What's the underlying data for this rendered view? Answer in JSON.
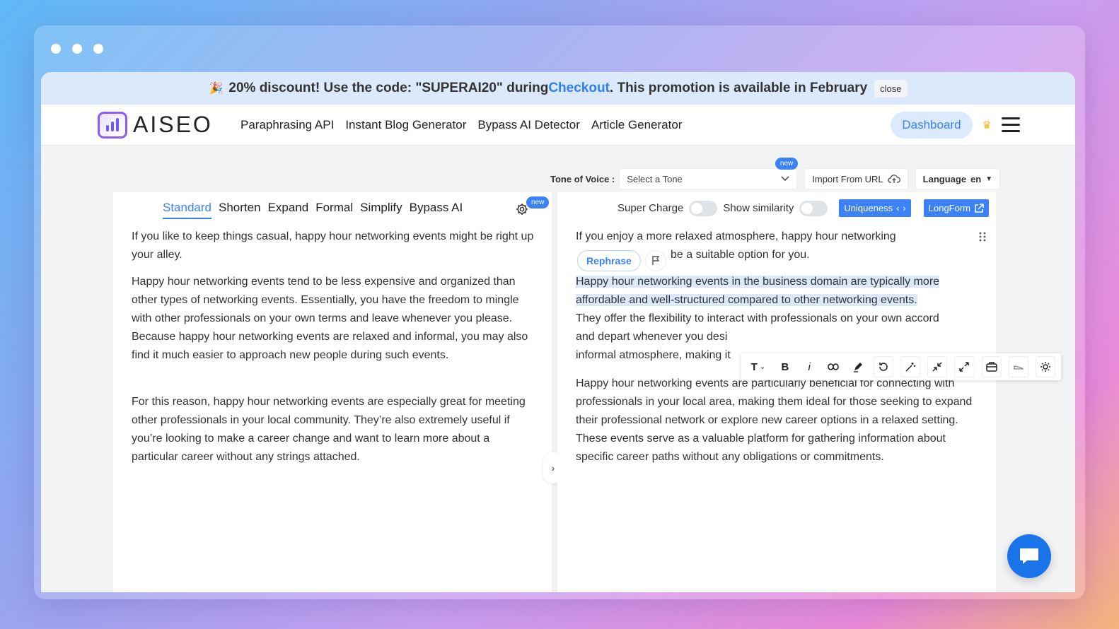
{
  "promo": {
    "emoji": "🎉",
    "text_before": "20% discount! Use the code: \"SUPERAI20\" during ",
    "link": "Checkout",
    "text_after": ". This promotion is available in February",
    "close_label": "close"
  },
  "nav": {
    "logo_text": "AISEO",
    "links": [
      "Paraphrasing API",
      "Instant Blog Generator",
      "Bypass AI Detector",
      "Article Generator"
    ],
    "dashboard_label": "Dashboard"
  },
  "toolbar": {
    "tone_label": "Tone of Voice :",
    "tone_placeholder": "Select a Tone",
    "new_badge": "new",
    "import_label": "Import From URL",
    "language_label": "Language",
    "language_value": "en"
  },
  "left": {
    "tabs": [
      "Standard",
      "Shorten",
      "Expand",
      "Formal",
      "Simplify",
      "Bypass AI"
    ],
    "active_tab": "Standard",
    "settings_badge": "new",
    "paragraphs": [
      "If you like to keep things casual, happy hour networking events might be right up your alley.",
      "Happy hour networking events tend to be less expensive and organized than other types of networking events. Essentially, you have the freedom to mingle with other professionals on your own terms and leave whenever you please. Because happy hour networking events are relaxed and informal, you may also find it much easier to approach new people during such events.",
      "For this reason, happy hour networking events are especially great for meeting other professionals in your local community. They’re also extremely useful if you’re looking to make a career change and want to learn more about a particular career without any strings attached."
    ]
  },
  "right": {
    "super_charge_label": "Super Charge",
    "show_similarity_label": "Show similarity",
    "uniqueness_label": "Uniqueness",
    "longform_label": "LongForm",
    "rephrase_label": "Rephrase",
    "p1_line1": "If you enjoy a more relaxed atmosphere, happy hour networking",
    "p1_line2": "be a suitable option for you.",
    "p2_highlight": "Happy hour networking events in the business domain are typically more affordable and well-structured compared to other networking events.",
    "p2_line3": "They offer the flexibility to interact with professionals on your own accord",
    "p2_line4": "and depart whenever you desi",
    "p2_line5": "informal atmosphere, making it",
    "p3": "Happy hour networking events are particularly beneficial for connecting with professionals in your local area, making them ideal for those seeking to expand their professional network or explore new career options in a relaxed setting. These events serve as a valuable platform for gathering information about specific career paths without any obligations or commitments."
  },
  "format_toolbar": {
    "text_icon": "T",
    "bold_icon": "B",
    "italic_icon": "i"
  },
  "colors": {
    "accent": "#3b82f6",
    "promo_bg": "#dbe9fb",
    "highlight": "#dbe9fb"
  }
}
